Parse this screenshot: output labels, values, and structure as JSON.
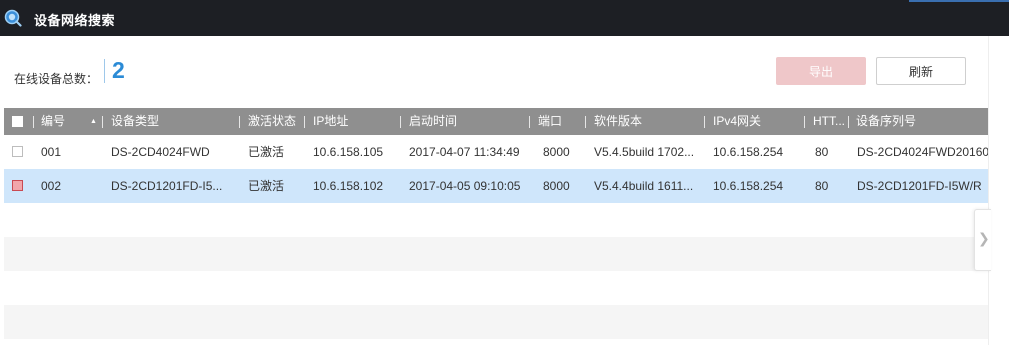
{
  "window": {
    "title": "设备网络搜索"
  },
  "summary": {
    "label": "在线设备总数：",
    "count": "2"
  },
  "toolbar": {
    "export_label": "导出",
    "refresh_label": "刷新"
  },
  "table": {
    "headers": {
      "no": "编号",
      "type": "设备类型",
      "status": "激活状态",
      "ip": "IP地址",
      "start_time": "启动时间",
      "port": "端口",
      "software": "软件版本",
      "gateway": "IPv4网关",
      "http": "HTT...",
      "serial": "设备序列号"
    },
    "sort_indicator": "▲",
    "rows": [
      {
        "no": "001",
        "type": "DS-2CD4024FWD",
        "status": "已激活",
        "ip": "10.6.158.105",
        "start_time": "2017-04-07 11:34:49",
        "port": "8000",
        "software": "V5.4.5build 1702...",
        "gateway": "10.6.158.254",
        "http": "80",
        "serial": "DS-2CD4024FWD20160",
        "checked": false
      },
      {
        "no": "002",
        "type": "DS-2CD1201FD-I5...",
        "status": "已激活",
        "ip": "10.6.158.102",
        "start_time": "2017-04-05 09:10:05",
        "port": "8000",
        "software": "V5.4.4build 1611...",
        "gateway": "10.6.158.254",
        "http": "80",
        "serial": "DS-2CD1201FD-I5W/R",
        "checked": true
      }
    ]
  },
  "icons": {
    "app": "search-globe-icon",
    "sort": "sort-ascending-icon",
    "expand": "chevron-right-icon"
  },
  "colors": {
    "titlebar": "#1d1f24",
    "count": "#2b8bd6",
    "selected_row": "#cfe6fb",
    "export_disabled": "#efc7c9"
  }
}
